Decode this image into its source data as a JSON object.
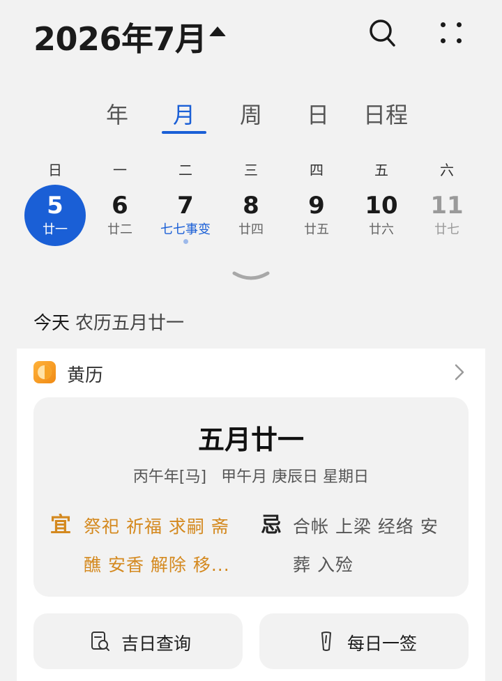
{
  "header": {
    "month_title": "2026年7月",
    "caret_icon": "caret-up-icon",
    "search_icon": "search-icon",
    "more_icon": "more-dots-icon"
  },
  "view_tabs": [
    "年",
    "月",
    "周",
    "日",
    "日程"
  ],
  "active_tab": "月",
  "week": {
    "weekdays": [
      "日",
      "一",
      "二",
      "三",
      "四",
      "五",
      "六"
    ],
    "days": [
      {
        "num": "5",
        "sub": "廿一",
        "selected": true
      },
      {
        "num": "6",
        "sub": "廿二"
      },
      {
        "num": "7",
        "sub": "七七事变",
        "holiday": true,
        "has_event": true
      },
      {
        "num": "8",
        "sub": "廿四"
      },
      {
        "num": "9",
        "sub": "廿五"
      },
      {
        "num": "10",
        "sub": "廿六"
      },
      {
        "num": "11",
        "sub": "廿七",
        "weekend": true
      }
    ]
  },
  "expand_icon": "chevron-down-icon",
  "today": {
    "label": "今天",
    "lunar": "农历五月廿一"
  },
  "almanac": {
    "title": "黄历",
    "lunar_date": "五月廿一",
    "ganzhi": "丙午年[马]   甲午月 庚辰日 星期日",
    "yi_label": "宜",
    "yi_lines": [
      "祭祀 祈福 求嗣 斋",
      "醮 安香 解除 移..."
    ],
    "ji_label": "忌",
    "ji_lines": [
      "合帐 上梁 经络 安",
      "葬 入殓"
    ],
    "buttons": [
      {
        "label": "吉日查询",
        "icon": "calendar-search-icon"
      },
      {
        "label": "每日一签",
        "icon": "fortune-stick-icon"
      }
    ],
    "colors": {
      "accent": "#1a5fd6",
      "yi": "#d4891f"
    }
  }
}
